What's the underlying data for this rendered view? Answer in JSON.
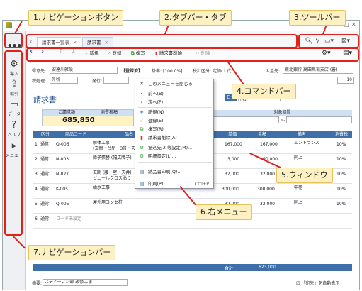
{
  "annotations": {
    "nav_button": "1.ナビゲーションボタン",
    "tabbar": "2.タブバー・タブ",
    "toolbar": "3.ツールバー",
    "command_bar": "4.コマンドバー",
    "window": "5.ウィンドウ",
    "right_menu": "6.右メニュー",
    "nav_bar": "7.ナビゲーションバー"
  },
  "nav_menu_icon": "•••",
  "nav": [
    {
      "label": "導入",
      "icon": "gear-icon",
      "glyph": "⚙"
    },
    {
      "label": "取引",
      "icon": "export-icon",
      "glyph": "⇪"
    },
    {
      "label": "データ",
      "icon": "folder-icon",
      "glyph": "▭"
    },
    {
      "label": "ヘルプ",
      "icon": "help-icon",
      "glyph": "?"
    },
    {
      "label": "メニュー",
      "icon": "menu-arrow-icon",
      "glyph": "▸"
    }
  ],
  "tabs": [
    {
      "label": "請求書一覧表"
    },
    {
      "label": "請求書"
    }
  ],
  "commands": {
    "new": "新規",
    "register": "登録",
    "copy": "複写",
    "delete": "請求書削除",
    "print": "削除",
    "more": "···"
  },
  "form": {
    "customer_label": "得意先:",
    "customer_value": "安達川雑設",
    "registered_tag": "【登録済】",
    "rate_label": "掛率:",
    "rate_value": "[100.0%]",
    "tax_label": "税計区分:",
    "tax_value": "定価(上代)",
    "deposit_label": "入金先:",
    "deposit_value": "東北銀行 高田馬場支店 (普)",
    "tax_type_label": "税処理:",
    "tax_type_value": "外税",
    "issue_label": "発行:",
    "doc_no": "10",
    "date_label": "日付",
    "subject_label": "件名",
    "period_label": "対象期間",
    "period_sep": "〜"
  },
  "doc_title": "請求書",
  "summary": {
    "amount_label": "ご請求額",
    "tax_label": "消費税額",
    "amount_value": "685,850"
  },
  "columns": [
    "区分",
    "商品コード",
    "品名",
    "単価",
    "金額",
    "備考",
    "消費税"
  ],
  "rows": [
    {
      "no": "1",
      "kind": "通常",
      "code": "Q-006",
      "name": "解体工事",
      "sub": "(玄関・台所・3畳・天井",
      "price": "167,000",
      "amount": "167,000",
      "note": "エントランス",
      "tax": "10%"
    },
    {
      "no": "2",
      "kind": "通常",
      "code": "N-003",
      "name": "障子張替 (幅広障子)",
      "sub": "",
      "price": "3,000",
      "amount": "90,000",
      "note": "同上",
      "tax": "10%"
    },
    {
      "no": "3",
      "kind": "通常",
      "code": "N-027",
      "name": "玄関 (腰・壁・天井)",
      "sub": "ビニールクロス貼り",
      "price": "32,000",
      "amount": "32,000",
      "note": "",
      "tax": "10%"
    },
    {
      "no": "4",
      "kind": "通常",
      "code": "K-005",
      "name": "給水工事",
      "sub": "",
      "price": "300,000",
      "amount": "300,000",
      "note": "中極",
      "tax": "10%"
    },
    {
      "no": "5",
      "kind": "通常",
      "code": "Q-005",
      "name": "屋外用コンセ柱",
      "sub": "",
      "price": "32,000",
      "amount": "32,000",
      "note": "同上",
      "tax": "10%"
    },
    {
      "no": "6",
      "kind": "通常",
      "code": "コード未設定",
      "name": "",
      "sub": "",
      "price": "",
      "amount": "",
      "note": "",
      "tax": ""
    }
  ],
  "total": {
    "label": "合計",
    "value": "623,000"
  },
  "footer": {
    "remark_label": "摘要:",
    "remark_value": "スティーブン邸 改修工事",
    "check_label": "「宛先」を自動表示"
  },
  "context_menu": [
    {
      "label": "このメニューを閉じる",
      "icon": "close-icon",
      "glyph": "✕",
      "shortcut": ""
    },
    {
      "label": "前へ(B)",
      "icon": "prev-icon",
      "glyph": "‹",
      "shortcut": ""
    },
    {
      "label": "次へ(F)",
      "icon": "next-icon",
      "glyph": "›",
      "shortcut": ""
    },
    {
      "label": "新規(N)",
      "icon": "plus-icon",
      "glyph": "+",
      "shortcut": ""
    },
    {
      "label": "登録(E)",
      "icon": "check-icon",
      "glyph": "✓",
      "shortcut": ""
    },
    {
      "label": "複写(R)",
      "icon": "copy-icon",
      "glyph": "⧉",
      "shortcut": ""
    },
    {
      "label": "請求書削除(A)",
      "icon": "trash-icon",
      "glyph": "✖",
      "shortcut": ""
    },
    {
      "label": "振込先 2 等設定(M)...",
      "icon": "settings-icon",
      "glyph": "⚙",
      "shortcut": ""
    },
    {
      "label": "明細設定(L)...",
      "icon": "settings-icon",
      "glyph": "⚙",
      "shortcut": ""
    },
    {
      "label": "納品書印刷(Q)...",
      "icon": "printer-icon",
      "glyph": "▤",
      "shortcut": ""
    },
    {
      "label": "印刷(P)...",
      "icon": "printer-icon",
      "glyph": "▤",
      "shortcut": "Ctrl+P"
    }
  ],
  "colors": {
    "accent": "#e2201c",
    "header": "#3f6fa8",
    "callout": "#fdf0c2"
  }
}
